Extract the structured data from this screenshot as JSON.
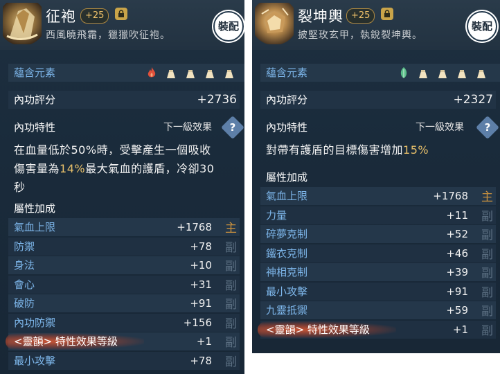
{
  "left": {
    "name": "征袍",
    "level_badge": "+25",
    "desc": "西風曉飛霜，獵獵吹征袍。",
    "equip_label": "裝配",
    "element_label": "蘊含元素",
    "score_label": "內功評分",
    "score_value": "+2736",
    "trait_label": "內功特性",
    "next_label": "下一級效果",
    "help_glyph": "?",
    "effect_lines": {
      "l1": "在血量低於50%時，受擊產生一個吸收",
      "l2a": "傷害量為",
      "l2b": "14%",
      "l2c": "最大氣血的護盾，冷卻30",
      "l3": "秒"
    },
    "attr_label": "屬性加成",
    "stats": [
      {
        "name": "氣血上限",
        "value": "+1768",
        "tag": "主",
        "tag_type": "main"
      },
      {
        "name": "防禦",
        "value": "+78",
        "tag": "副",
        "tag_type": "sub"
      },
      {
        "name": "身法",
        "value": "+10",
        "tag": "副",
        "tag_type": "sub"
      },
      {
        "name": "會心",
        "value": "+31",
        "tag": "副",
        "tag_type": "sub"
      },
      {
        "name": "破防",
        "value": "+91",
        "tag": "副",
        "tag_type": "sub"
      },
      {
        "name": "內功防禦",
        "value": "+156",
        "tag": "副",
        "tag_type": "sub"
      },
      {
        "name": "<靈韻> 特性效果等級",
        "value": "+1",
        "tag": "副",
        "tag_type": "sub"
      },
      {
        "name": "最小攻擊",
        "value": "+78",
        "tag": "副",
        "tag_type": "sub"
      }
    ]
  },
  "right": {
    "name": "裂坤輿",
    "level_badge": "+25",
    "desc": "披堅玫玄甲，執銳裂坤輿。",
    "equip_label": "裝配",
    "element_label": "蘊含元素",
    "score_label": "內功評分",
    "score_value": "+2327",
    "trait_label": "內功特性",
    "next_label": "下一級效果",
    "help_glyph": "?",
    "effect_a": "對帶有護盾的目標傷害增加",
    "effect_b": "15%",
    "attr_label": "屬性加成",
    "stats": [
      {
        "name": "氣血上限",
        "value": "+1768",
        "tag": "主",
        "tag_type": "main"
      },
      {
        "name": "力量",
        "value": "+11",
        "tag": "副",
        "tag_type": "sub"
      },
      {
        "name": "碎夢克制",
        "value": "+52",
        "tag": "副",
        "tag_type": "sub"
      },
      {
        "name": "鐵衣克制",
        "value": "+46",
        "tag": "副",
        "tag_type": "sub"
      },
      {
        "name": "神相克制",
        "value": "+39",
        "tag": "副",
        "tag_type": "sub"
      },
      {
        "name": "最小攻擊",
        "value": "+91",
        "tag": "副",
        "tag_type": "sub"
      },
      {
        "name": "九靈抵禦",
        "value": "+59",
        "tag": "副",
        "tag_type": "sub"
      },
      {
        "name": "<靈韻> 特性效果等級",
        "value": "+1",
        "tag": "副",
        "tag_type": "sub"
      }
    ]
  },
  "colors": {
    "accent_blue": "#7db6ea",
    "highlight_gold": "#e8c06a",
    "main_tag": "#c9913e",
    "sub_tag": "#5b6f82",
    "fire_element": "#e0503a",
    "wood_element": "#5bbf8a"
  },
  "icons": {
    "left_item": "robe-item-icon",
    "right_item": "armor-item-icon",
    "lock": "lock-icon",
    "help": "help-diamond-icon",
    "fire": "fire-element-icon",
    "leaf": "leaf-element-icon",
    "empty_slot": "empty-element-slot-icon"
  }
}
